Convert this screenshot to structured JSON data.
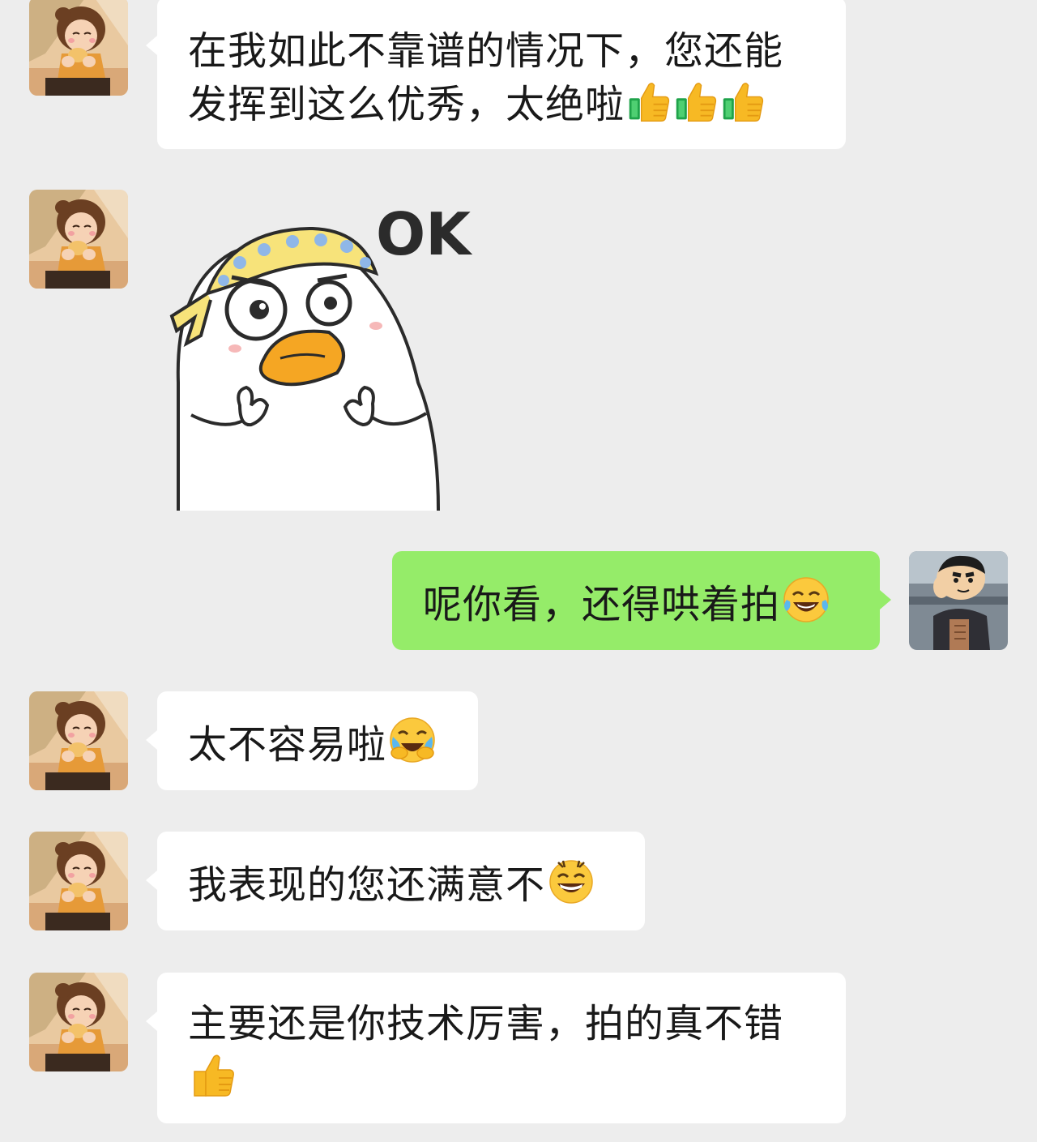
{
  "messages": [
    {
      "side": "in",
      "text": "在我如此不靠谱的情况下，您还能发挥到这么优秀，太绝啦",
      "emojis": [
        "thumbs-up-icon",
        "thumbs-up-icon",
        "thumbs-up-icon"
      ]
    },
    {
      "side": "in",
      "type": "sticker",
      "sticker_text": "OK",
      "sticker_name": "duck-ok-sticker"
    },
    {
      "side": "out",
      "text": "呢你看，还得哄着拍",
      "emojis": [
        "laughing-tears-icon"
      ]
    },
    {
      "side": "in",
      "text": "太不容易啦",
      "emojis": [
        "crying-laughing-face-icon"
      ]
    },
    {
      "side": "in",
      "text": "我表现的您还满意不",
      "emojis": [
        "grinning-face-icon"
      ]
    },
    {
      "side": "in",
      "text": "主要还是你技术厉害，拍的真不错",
      "emojis": [
        "thumbs-up-icon"
      ]
    }
  ],
  "colors": {
    "background": "#ededed",
    "incoming_bubble": "#ffffff",
    "outgoing_bubble": "#95ec69",
    "text": "#191919"
  }
}
